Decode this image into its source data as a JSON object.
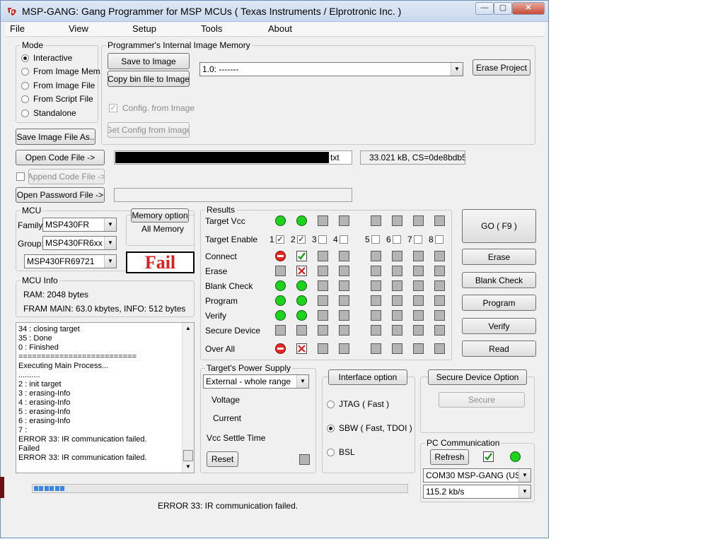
{
  "window": {
    "title": "MSP-GANG:  Gang Programmer for MSP MCUs ( Texas Instruments / Elprotronic Inc. )",
    "min": "—",
    "max": "▢",
    "close": "✕"
  },
  "menu": [
    "File",
    "View",
    "Setup",
    "Tools",
    "About"
  ],
  "mode": {
    "label": "Mode",
    "options": [
      "Interactive",
      "From Image Mem.",
      "From Image File",
      "From Script File",
      "Standalone"
    ],
    "selected": 0,
    "save_button": "Save Image File As.."
  },
  "image_memory": {
    "label": "Programmer's Internal Image Memory",
    "save_to_image": "Save to Image",
    "copy_bin": "Copy bin file to Image",
    "image_select": "1.0:  -------",
    "erase_project": "Erase Project",
    "config_from_image": "Config. from Image",
    "get_config": "Get Config from Image"
  },
  "code_file": {
    "open_button": "Open Code File ->",
    "file_suffix": "txt",
    "info": "33.021 kB, CS=0de8bdb5",
    "append_button": "Append Code File ->",
    "open_password": "Open Password File ->",
    "password_path": ""
  },
  "mcu": {
    "label": "MCU",
    "family_label": "Family:",
    "family": "MSP430FR",
    "group_label": "Group:",
    "group": "MSP430FR6xx",
    "device": "MSP430FR69721",
    "memory_option_button": "Memory option",
    "memory_option_value": "All Memory",
    "status": "Fail"
  },
  "mcu_info": {
    "label": "MCU Info",
    "ram": "RAM:  2048 bytes",
    "fram": "FRAM  MAIN:  63.0 kbytes,  INFO: 512 bytes"
  },
  "log": [
    "34 : closing target",
    "35 : Done",
    " 0 : Finished",
    "==========================",
    "Executing Main Process...",
    "..........",
    " 2 : init target",
    " 3 : erasing-Info",
    " 4 : erasing-Info",
    " 5 : erasing-Info",
    " 6 : erasing-Info",
    " 7 :",
    "ERROR 33: IR communication failed.",
    "Failed",
    "ERROR 33: IR communication failed."
  ],
  "results": {
    "label": "Results",
    "rows": [
      "Target Vcc",
      "Target Enable",
      "Connect",
      "Erase",
      "Blank Check",
      "Program",
      "Verify",
      "Secure Device",
      "Over All"
    ],
    "enable_numbers": [
      "1",
      "2",
      "3",
      "4",
      "5",
      "6",
      "7",
      "8"
    ],
    "enable_checked": [
      true,
      true,
      false,
      false,
      false,
      false,
      false,
      false
    ],
    "status": {
      "Target Vcc": [
        "ok",
        "ok",
        "none",
        "none",
        "none",
        "none",
        "none",
        "none"
      ],
      "Connect": [
        "stop",
        "check",
        "none",
        "none",
        "none",
        "none",
        "none",
        "none"
      ],
      "Erase": [
        "none",
        "cross",
        "none",
        "none",
        "none",
        "none",
        "none",
        "none"
      ],
      "Blank Check": [
        "ok",
        "ok",
        "none",
        "none",
        "none",
        "none",
        "none",
        "none"
      ],
      "Program": [
        "ok",
        "ok",
        "none",
        "none",
        "none",
        "none",
        "none",
        "none"
      ],
      "Verify": [
        "ok",
        "ok",
        "none",
        "none",
        "none",
        "none",
        "none",
        "none"
      ],
      "Secure Device": [
        "none",
        "none",
        "none",
        "none",
        "none",
        "none",
        "none",
        "none"
      ],
      "Over All": [
        "stop",
        "cross",
        "none",
        "none",
        "none",
        "none",
        "none",
        "none"
      ]
    }
  },
  "actions": {
    "go": "GO    ( F9 )",
    "erase": "Erase",
    "blank_check": "Blank Check",
    "program": "Program",
    "verify": "Verify",
    "read": "Read"
  },
  "power": {
    "label": "Target's Power Supply",
    "select": "External - whole range",
    "voltage": "Voltage",
    "current": "Current",
    "settle": "Vcc Settle Time",
    "reset": "Reset"
  },
  "interface": {
    "button": "Interface option",
    "options": [
      "JTAG  ( Fast )",
      "SBW  ( Fast, TDOI )",
      "BSL"
    ],
    "selected": 1
  },
  "secure": {
    "button": "Secure Device Option",
    "secure_button": "Secure"
  },
  "pc_comm": {
    "label": "PC Communication",
    "refresh": "Refresh",
    "port": "COM30   MSP-GANG (USB)",
    "baud": "115.2 kb/s"
  },
  "progress": {
    "value": 0.09
  },
  "status_text": "ERROR 33: IR communication failed.",
  "colors": {
    "ok": "#1bd41b",
    "fail": "#e21b1b",
    "progress": "#3a86e0"
  }
}
